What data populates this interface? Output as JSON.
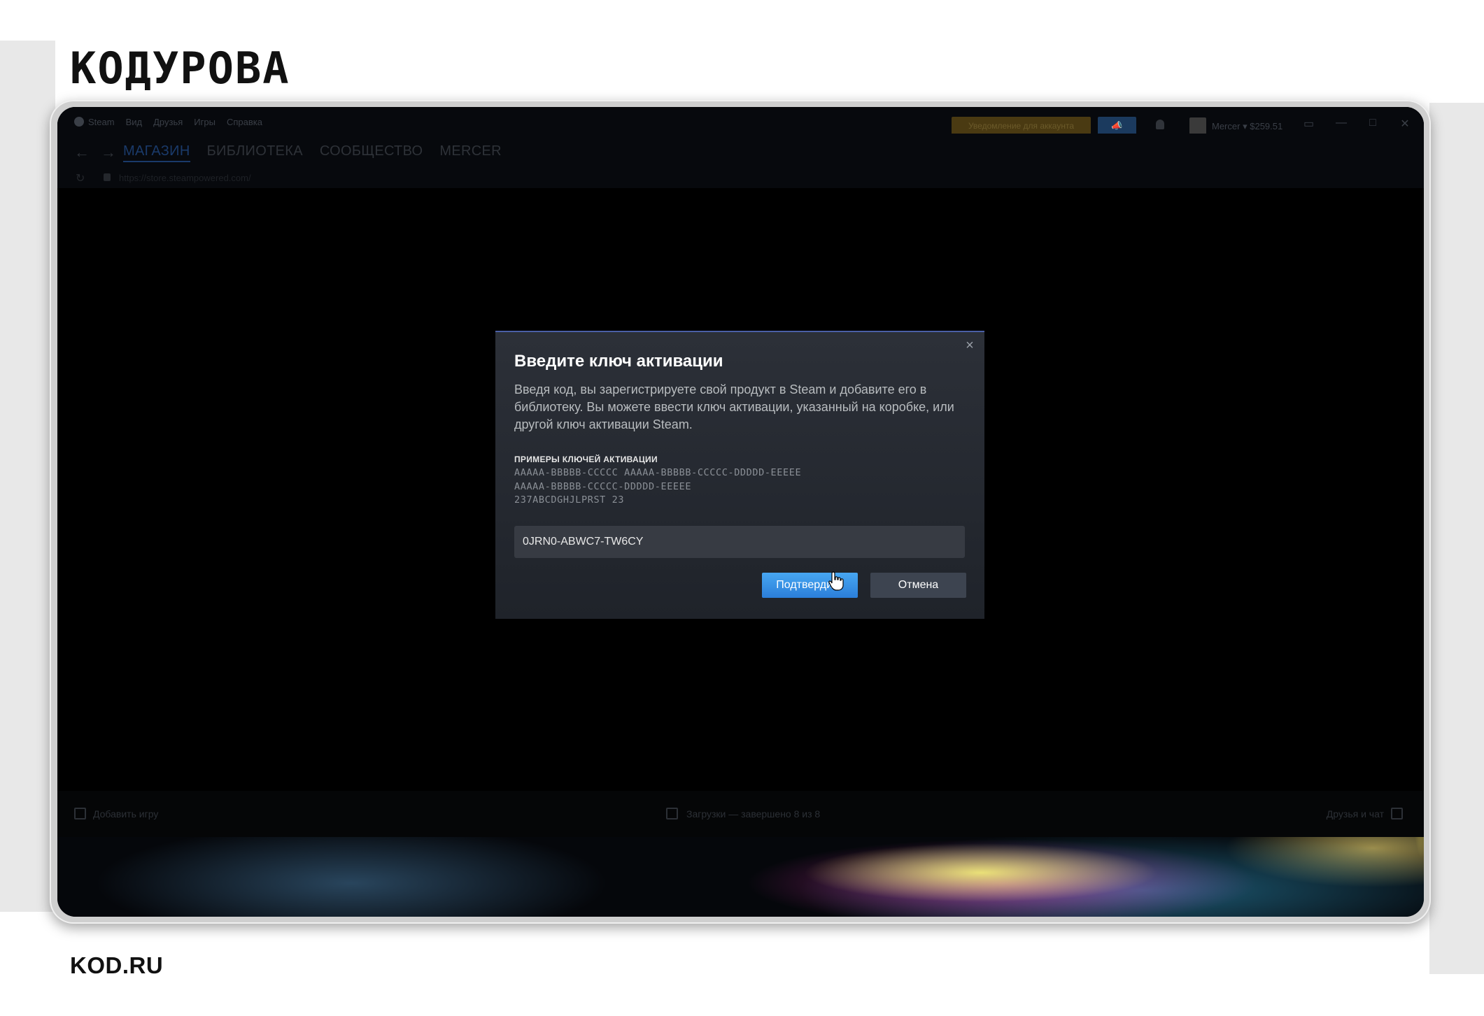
{
  "brand": {
    "logo_text": "KOДУPOBA",
    "footer_site": "KOD.RU"
  },
  "steam": {
    "titlebar": {
      "menu": [
        "Steam",
        "Вид",
        "Друзья",
        "Игры",
        "Справка"
      ],
      "notification_button": "Уведомление для аккаунта",
      "account_name": "Mercer",
      "balance": "$259.51"
    },
    "nav": {
      "tabs": [
        "МАГАЗИН",
        "БИБЛИОТЕКА",
        "СООБЩЕСТВО",
        "MERCER"
      ],
      "active_tab": "МАГАЗИН"
    },
    "url": "https://store.steampowered.com/",
    "status": {
      "add_game": "Добавить игру",
      "downloads": "Загрузки — завершено 8 из 8",
      "friends_chat": "Друзья и чат"
    }
  },
  "dialog": {
    "title": "Введите ключ активации",
    "description": "Введя код, вы зарегистрируете свой продукт в Steam и добавите его в библиотеку. Вы можете ввести ключ активации, указанный на коробке, или другой ключ активации Steam.",
    "examples_title": "ПРИМЕРЫ КЛЮЧЕЙ АКТИВАЦИИ",
    "examples": [
      "AAAAA-BBBBB-CCCCC AAAAA-BBBBB-CCCCC-DDDDD-EEEEE",
      "AAAAA-BBBBB-CCCCC-DDDDD-EEEEE",
      "237ABCDGHJLPRST 23"
    ],
    "key_value": "0JRN0-ABWC7-TW6CY",
    "confirm_label": "Подтвердить",
    "cancel_label": "Отмена"
  },
  "colors": {
    "dialog_accent": "#4a5fa6",
    "confirm_blue": "#2b7ed9",
    "notification_gold": "#4a3a12"
  }
}
